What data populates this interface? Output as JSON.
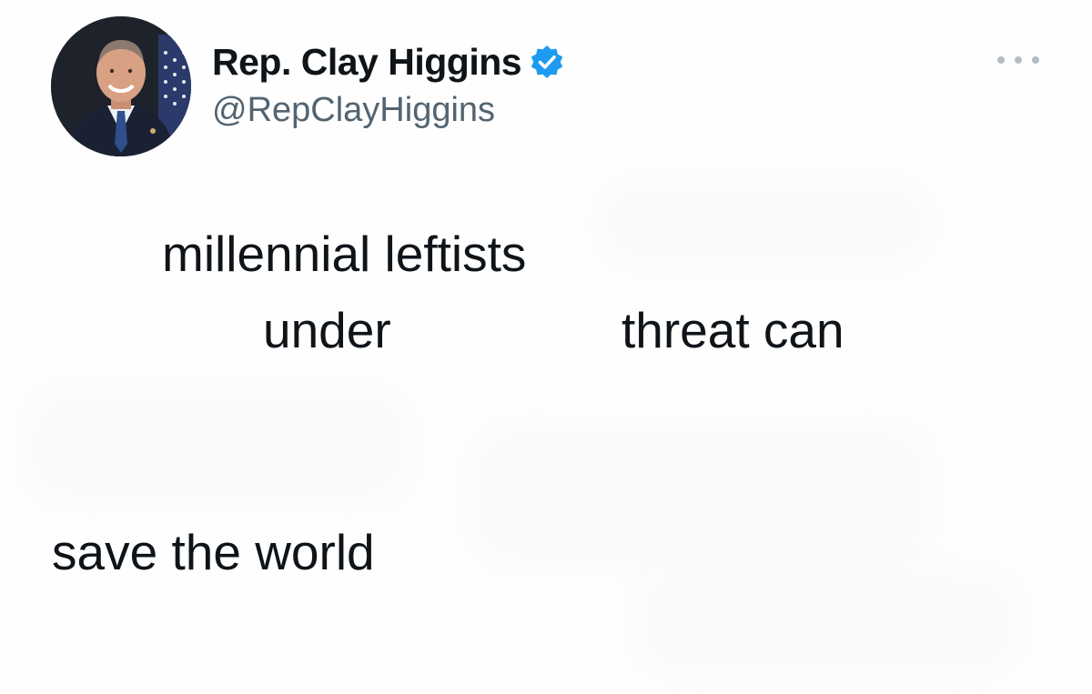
{
  "author": {
    "display_name": "Rep. Clay Higgins",
    "handle": "@RepClayHiggins",
    "verified": true,
    "verified_icon": "verified-badge-icon",
    "avatar_icon": "profile-photo"
  },
  "menu": {
    "icon": "more-options-icon"
  },
  "tweet_text": {
    "line1": "millennial leftists",
    "line2_left": "under",
    "line2_right": "threat can",
    "line3": "save the world"
  },
  "colors": {
    "text": "#0f1419",
    "secondary_text": "#536471",
    "verified_blue": "#1d9bf0",
    "background": "#ffffff"
  }
}
